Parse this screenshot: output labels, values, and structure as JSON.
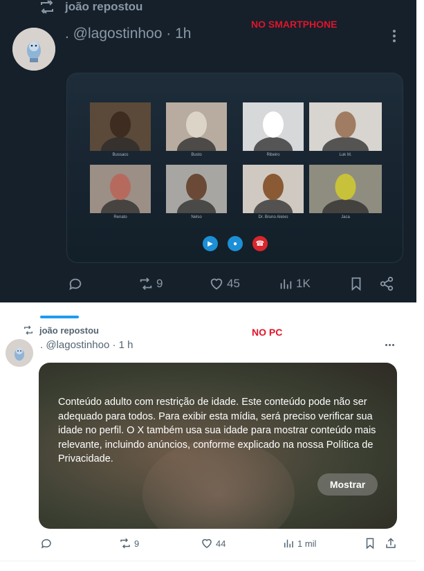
{
  "phone": {
    "repost_text": "joão repostou",
    "handle": ". @lagostinhoo · 1h",
    "label": "NO SMARTPHONE",
    "call_tiles": [
      {
        "name": "Bussaco",
        "bg": "#5b4a39",
        "face": "#3d2c1f"
      },
      {
        "name": "Busto",
        "bg": "#b8aca0",
        "face": "#ddd4c8"
      },
      {
        "name": "Ribeiro",
        "bg": "#d6d8da",
        "face": "#ffffff"
      },
      {
        "name": "Luk M.",
        "bg": "#d8d4cf",
        "face": "#a07c62"
      },
      {
        "name": "Renato",
        "bg": "#9b8f86",
        "face": "#b66a5e"
      },
      {
        "name": "Nelso",
        "bg": "#a7a6a2",
        "face": "#6a4a36"
      },
      {
        "name": "Dr. Bruno Aleixo",
        "bg": "#cfc9c2",
        "face": "#8a5a34"
      },
      {
        "name": "Jaca",
        "bg": "#8f8d80",
        "face": "#c8c23a"
      }
    ],
    "stats": {
      "reposts": "9",
      "likes": "45",
      "views": "1K"
    }
  },
  "pc": {
    "repost_text": "joão repostou",
    "handle": ". @lagostinhoo · 1 h",
    "label": "NO PC",
    "sensitive_text": "Conteúdo adulto com restrição de idade. Este conteúdo pode não ser adequado para todos. Para exibir esta mídia, será preciso verificar sua idade no perfil. O X também usa sua idade para mostrar conteúdo mais relevante, incluindo anúncios, conforme explicado na nossa Política de Privacidade.",
    "show_button": "Mostrar",
    "stats": {
      "reposts": "9",
      "likes": "44",
      "views": "1 mil"
    }
  },
  "colors": {
    "accent": "#1d9bf0",
    "label_red": "#e0142a",
    "dark_bg": "#15202b"
  }
}
